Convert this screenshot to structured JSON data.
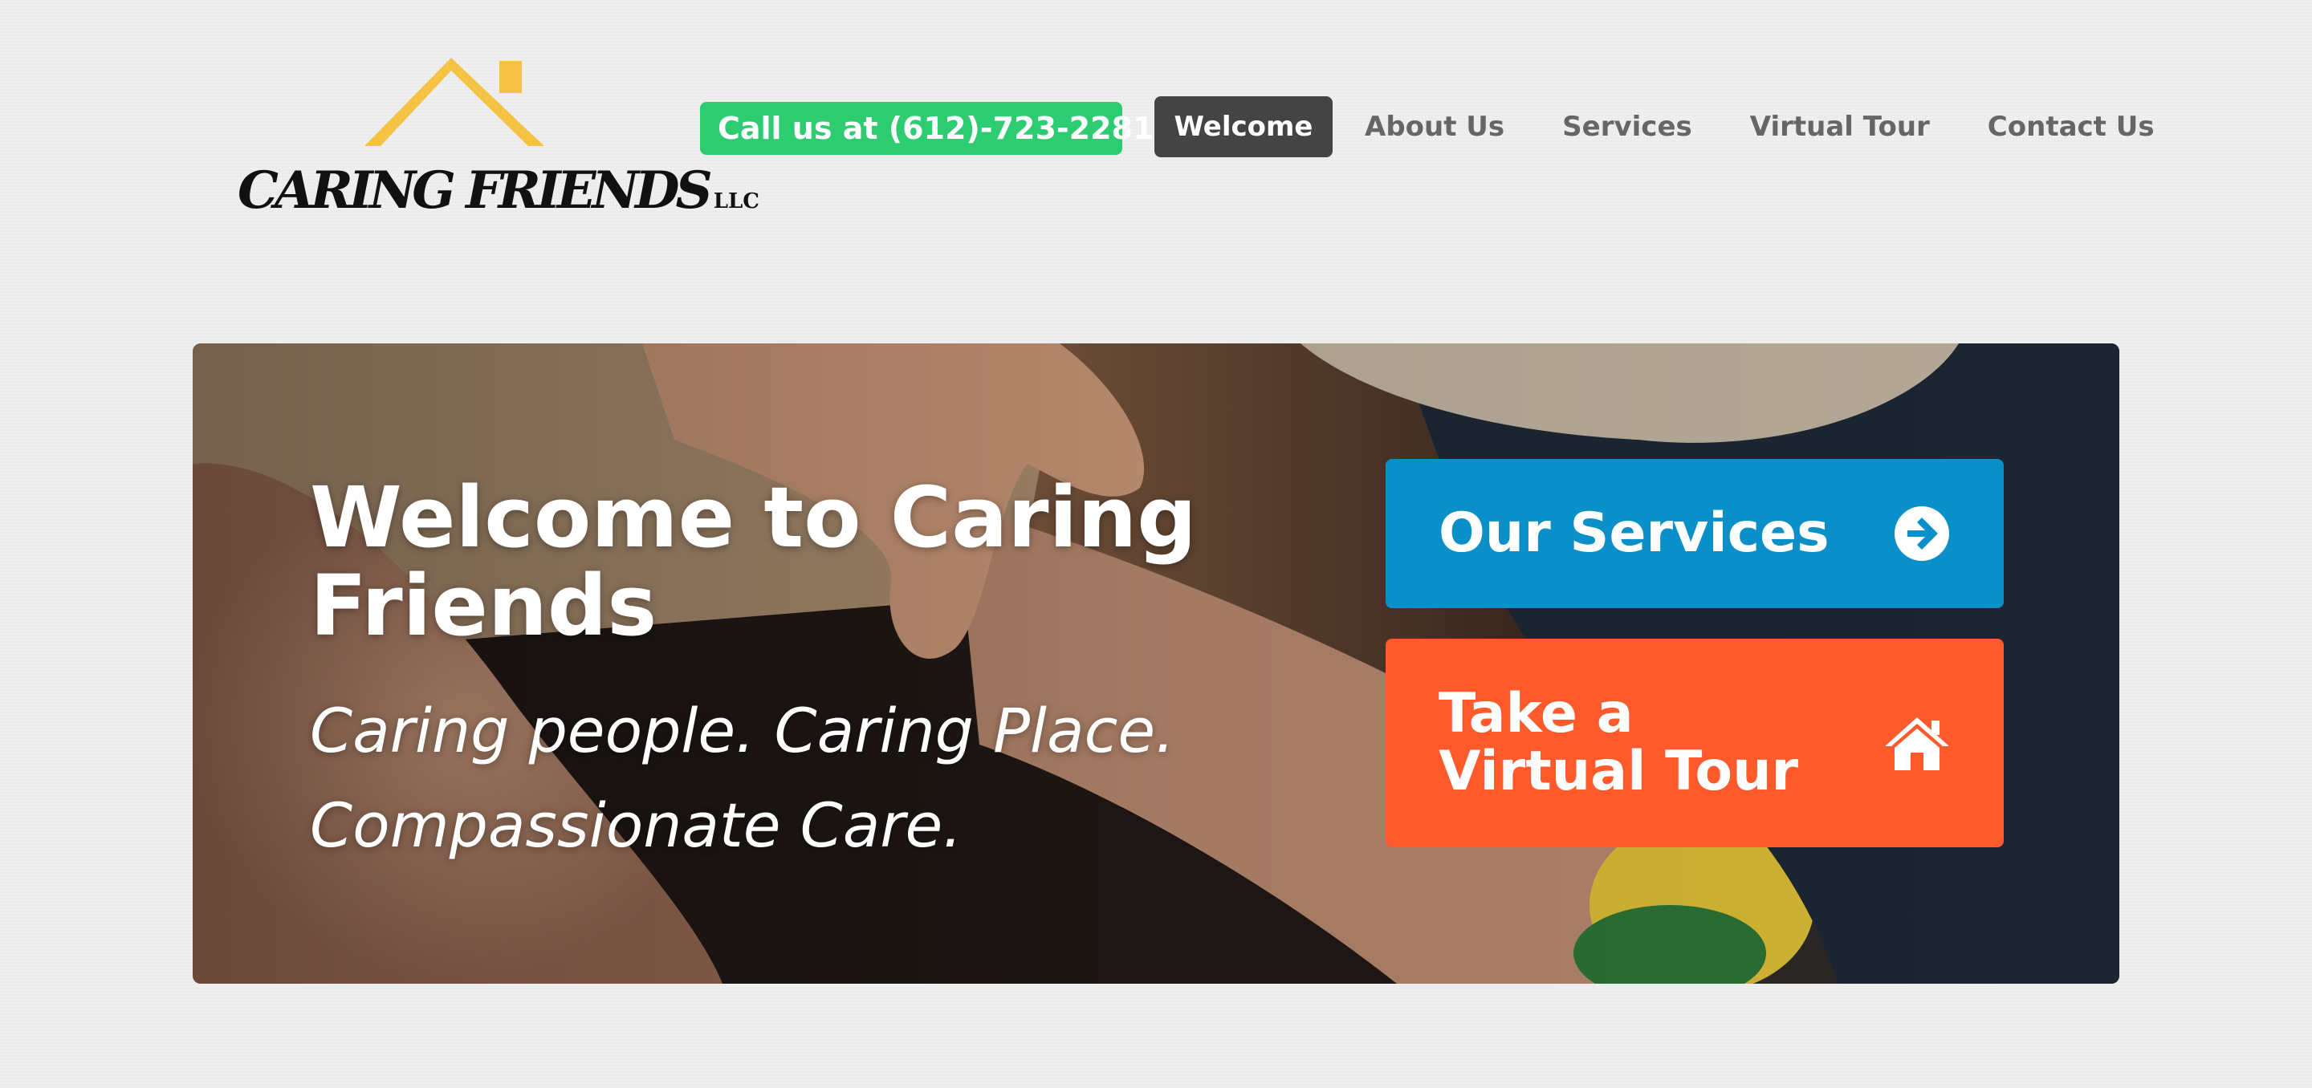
{
  "brand": {
    "name": "CARING FRIENDS",
    "suffix": "LLC",
    "roof_color": "#f5c343"
  },
  "header": {
    "call_button": {
      "label": "Call us at (612)-723-2281",
      "icon": "phone-icon",
      "color": "#2ecc71"
    },
    "nav": [
      {
        "label": "Welcome",
        "active": true
      },
      {
        "label": "About Us",
        "active": false
      },
      {
        "label": "Services",
        "active": false
      },
      {
        "label": "Virtual Tour",
        "active": false
      },
      {
        "label": "Contact Us",
        "active": false
      }
    ]
  },
  "hero": {
    "title": "Welcome to Caring Friends",
    "subtitle_line1": "Caring people. Caring Place.",
    "subtitle_line2": "Compassionate Care.",
    "cta_services": {
      "label": "Our Services",
      "icon": "arrow-right-circle-icon",
      "color": "#0b8fc9"
    },
    "cta_tour": {
      "label": "Take a Virtual Tour",
      "icon": "home-icon",
      "color": "#ff5a2c"
    }
  }
}
